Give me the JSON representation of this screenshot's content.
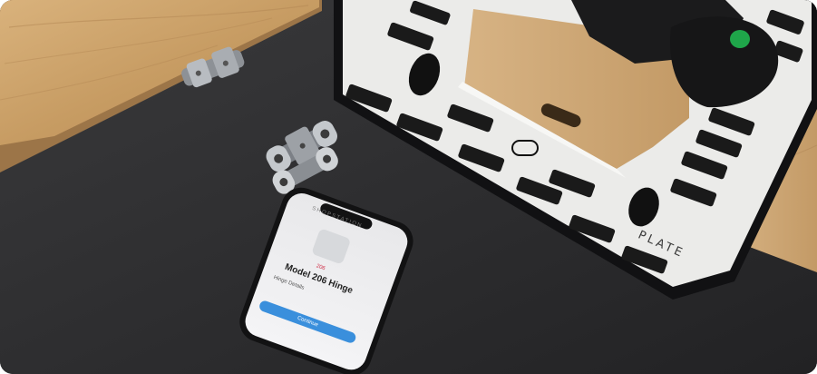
{
  "plate": {
    "brand_label": "PLATE"
  },
  "phone": {
    "app_header": "SHOPSTATION",
    "product_badge": "206",
    "product_title": "Model 206 Hinge",
    "section_label": "Hinge Details",
    "action_button": "Continue"
  },
  "colors": {
    "background": "#2b2b2d",
    "wood": "#c9a06a",
    "plate": "#e9e9e7",
    "plate_frame": "#141414",
    "jig_button": "#1fa64a",
    "phone_button": "#3a8fdc"
  }
}
